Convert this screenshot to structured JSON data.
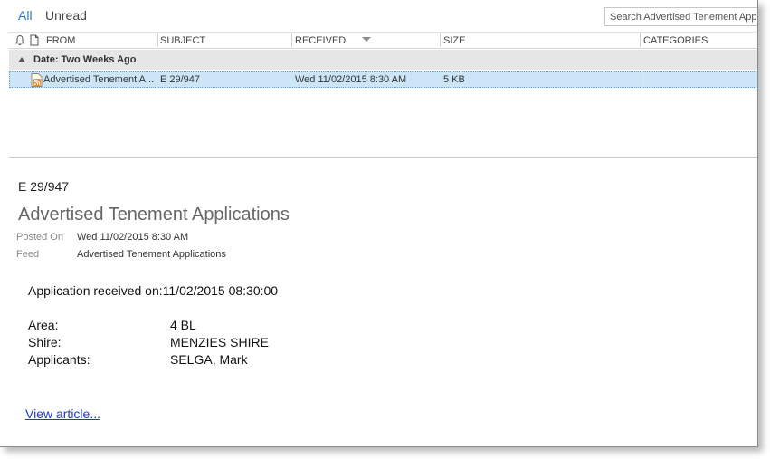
{
  "filters": {
    "all": "All",
    "unread": "Unread"
  },
  "search": {
    "placeholder": "Search Advertised Tenement Applications"
  },
  "columns": {
    "from": "FROM",
    "subject": "SUBJECT",
    "received": "RECEIVED",
    "size": "SIZE",
    "categories": "CATEGORIES"
  },
  "group": {
    "label": "Date: Two Weeks Ago"
  },
  "message": {
    "from": "Advertised Tenement A...",
    "subject": "E 29/947",
    "received": "Wed 11/02/2015 8:30 AM",
    "size": "5 KB"
  },
  "reading": {
    "subject": "E 29/947",
    "title": "Advertised Tenement Applications",
    "posted_on_label": "Posted On",
    "posted_on_value": "Wed 11/02/2015 8:30 AM",
    "feed_label": "Feed",
    "feed_value": "Advertised Tenement Applications",
    "received_line": "Application received on:11/02/2015 08:30:00",
    "fields": [
      {
        "label": "Area:",
        "value": "4 BL"
      },
      {
        "label": "Shire:",
        "value": "MENZIES SHIRE"
      },
      {
        "label": "Applicants:",
        "value": "SELGA, Mark"
      }
    ],
    "view_link": "View article..."
  },
  "colors": {
    "accent": "#2b79c5",
    "selection": "#cde6f7",
    "link": "#1f3bbf",
    "rss": "#f28c1f"
  }
}
